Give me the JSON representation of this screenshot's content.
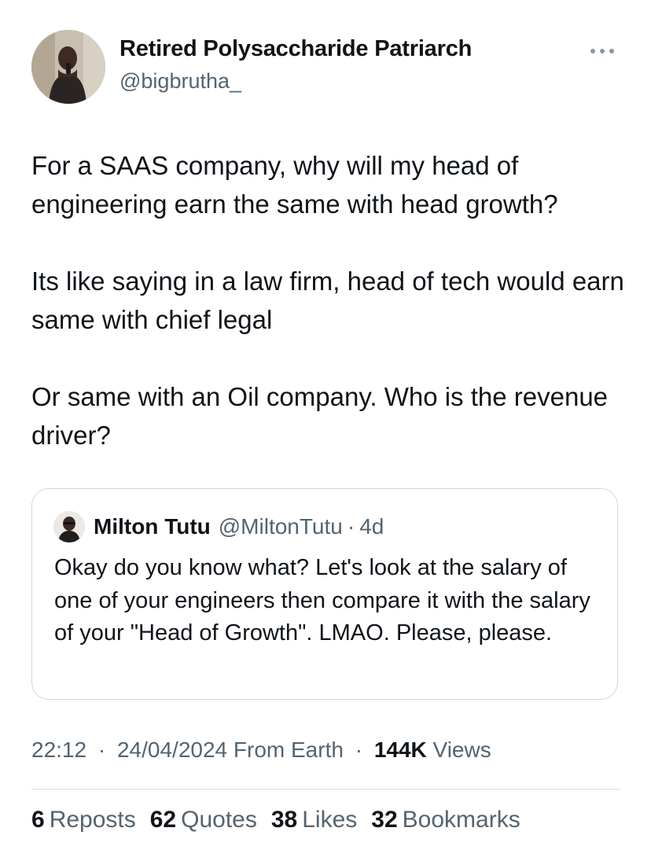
{
  "author": {
    "name": "Retired Polysaccharide Patriarch",
    "handle": "@bigbrutha_"
  },
  "more_icon": "more-horizontal-icon",
  "tweet": {
    "paragraphs": [
      "For a SAAS company, why will my head of engineering earn the same with head growth?",
      "Its like saying in a law firm, head of tech would earn same with chief legal",
      "Or same with an Oil company. Who is the revenue driver?"
    ]
  },
  "quote": {
    "name": "Milton Tutu",
    "handle": "@MiltonTutu",
    "dot": "·",
    "time": "4d",
    "text": "Okay do you know what? Let's look at the salary of one of your engineers then compare it with the salary of your \"Head of Growth\". LMAO. Please, please."
  },
  "meta": {
    "time": "22:12",
    "dot": "·",
    "date": "24/04/2024",
    "source": "From Earth",
    "views_count": "144K",
    "views_label": "Views"
  },
  "stats": {
    "reposts": {
      "count": "6",
      "label": "Reposts"
    },
    "quotes": {
      "count": "62",
      "label": "Quotes"
    },
    "likes": {
      "count": "38",
      "label": "Likes"
    },
    "bookmarks": {
      "count": "32",
      "label": "Bookmarks"
    }
  },
  "colors": {
    "text_primary": "#0f1419",
    "text_secondary": "#536471",
    "border": "#cfd9de"
  }
}
